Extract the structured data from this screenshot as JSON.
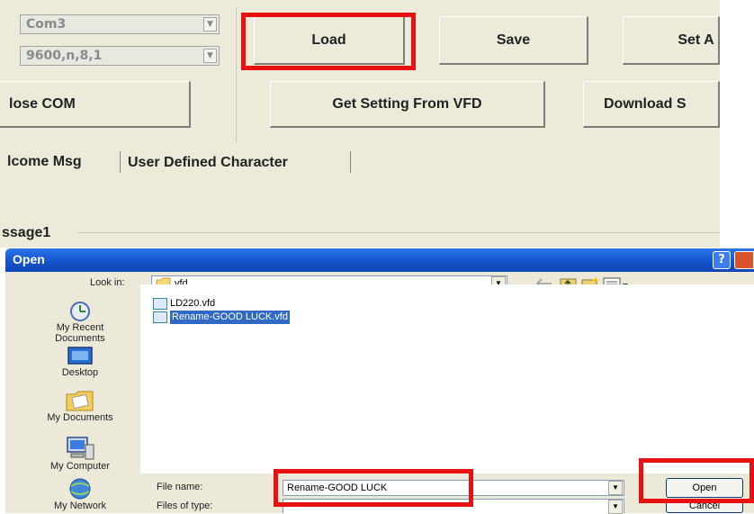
{
  "app": {
    "port_value": "Com3",
    "settings_value": "9600,n,8,1",
    "buttons": {
      "load": "Load",
      "save": "Save",
      "set": "Set A",
      "close_com": "lose COM",
      "get_setting": "Get Setting From VFD",
      "download": "Download S"
    },
    "tabs": [
      "lcome Msg",
      "User Defined Character"
    ],
    "group_label": "ssage1"
  },
  "dialog": {
    "title": "Open",
    "help_label": "?",
    "look_in_label": "Look in:",
    "look_in_value": "vfd",
    "places": [
      "My Recent Documents",
      "Desktop",
      "My Documents",
      "My Computer",
      "My Network"
    ],
    "files": [
      {
        "name": "LD220.vfd",
        "selected": false
      },
      {
        "name": "Rename-GOOD LUCK.vfd",
        "selected": true
      }
    ],
    "file_name_label": "File name:",
    "file_name_value": "Rename-GOOD LUCK",
    "file_type_label": "Files of type:",
    "open_button": "Open",
    "cancel_button": "Cancel"
  },
  "colors": {
    "highlight": "#e81010",
    "title_bar": "#1552c9",
    "selection": "#316ac5"
  }
}
